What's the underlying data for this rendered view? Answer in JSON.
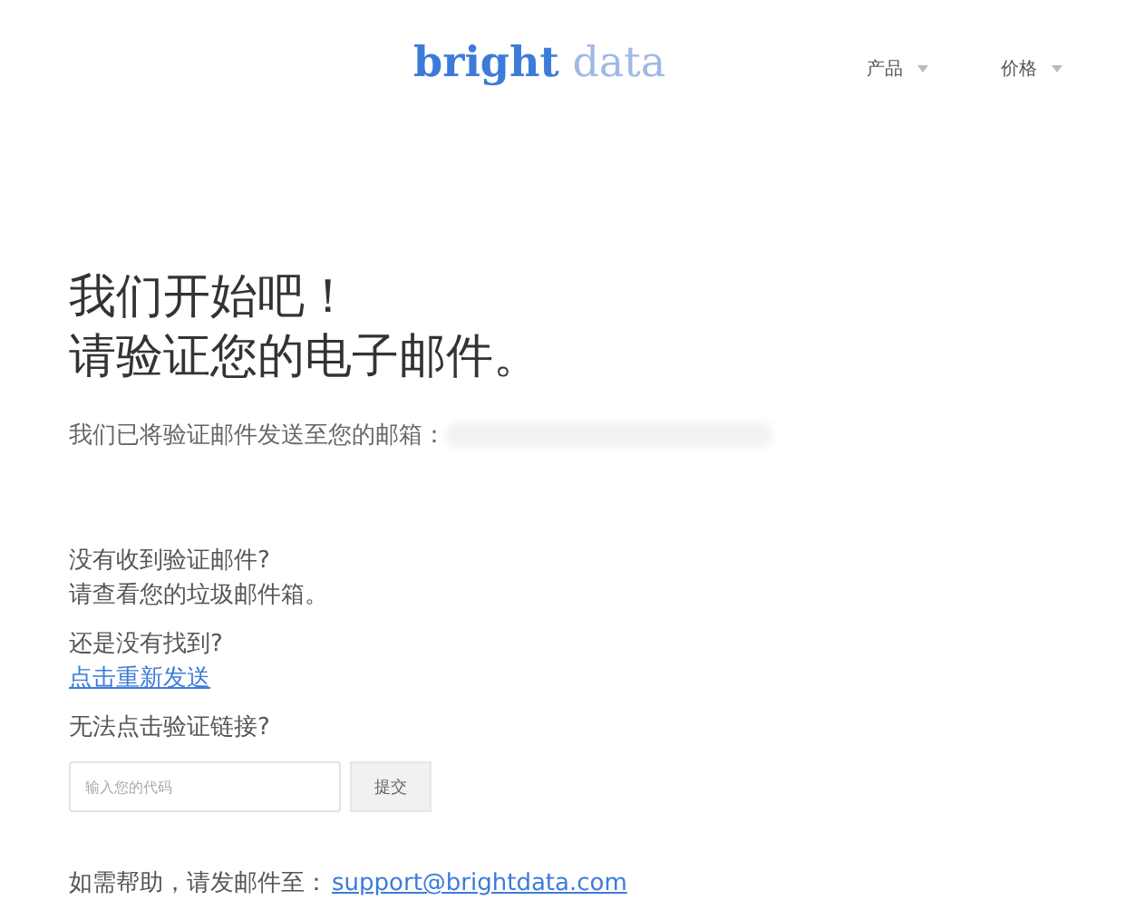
{
  "header": {
    "logo": {
      "bold": "bright",
      "light": "data"
    },
    "nav": [
      {
        "label": "产品"
      },
      {
        "label": "价格"
      }
    ]
  },
  "heading": [
    "我们开始吧！",
    "请验证您的电子邮件。"
  ],
  "sent_notice": "我们已将验证邮件发送至您的邮箱：",
  "help": [
    {
      "kind": "text",
      "lines": [
        "没有收到验证邮件?",
        "请查看您的垃圾邮件箱。"
      ]
    },
    {
      "kind": "link",
      "lines": [
        "还是没有找到?"
      ],
      "link": "点击重新发送"
    },
    {
      "kind": "code",
      "lines": [
        "无法点击验证链接?"
      ],
      "placeholder": "输入您的代码",
      "button": "提交"
    }
  ],
  "footer": {
    "text": "如需帮助，请发邮件至：",
    "email": "support@brightdata.com"
  }
}
